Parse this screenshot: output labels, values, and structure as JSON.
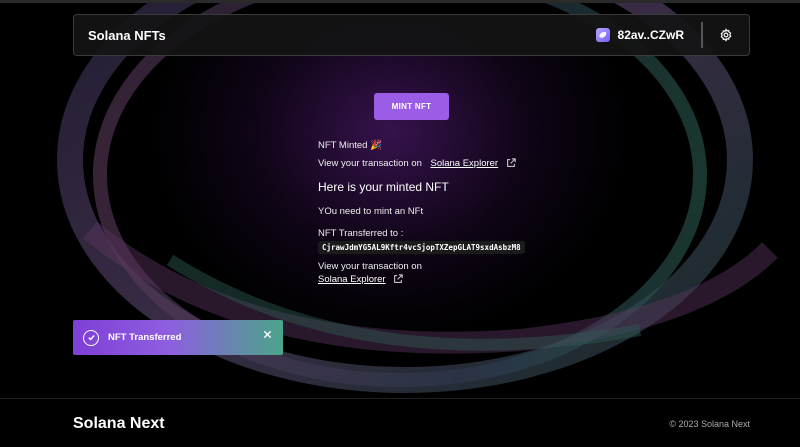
{
  "header": {
    "brand": "Solana NFTs",
    "wallet_label": "82av..CZwR"
  },
  "main": {
    "mint_button": "MINT NFT",
    "minted_status": "NFT Minted 🎉",
    "view_tx_prefix": "View your transaction on",
    "explorer_link": "Solana Explorer",
    "minted_heading": "Here is your minted NFT",
    "need_mint_msg": "YOu need to mint an NFt",
    "transferred_to_label": "NFT Transferred to :",
    "recipient_address": "CjrawJdmYG5AL9Kftr4vcSjopTXZepGLAT9sxdAsbzM8",
    "view_tx_prefix_2": "View your transaction on",
    "explorer_link_2": "Solana Explorer"
  },
  "toast": {
    "message": "NFT Transferred"
  },
  "footer": {
    "brand": "Solana Next",
    "copyright": "© 2023 Solana Next"
  },
  "colors": {
    "accent": "#9b5de5",
    "toast_start": "#7e3fd6",
    "toast_end": "#4aa58a",
    "background": "#000000"
  }
}
